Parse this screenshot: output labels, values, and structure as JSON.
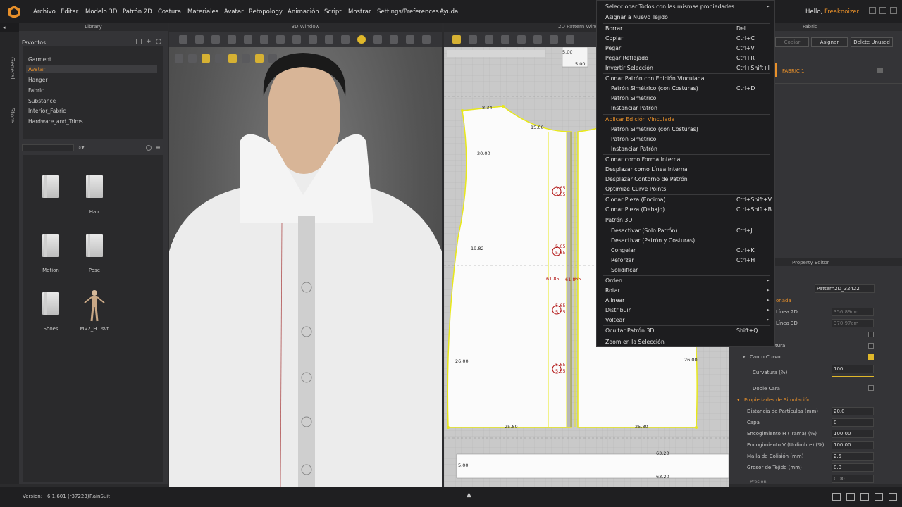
{
  "menubar": {
    "items": [
      "Archivo",
      "Editar",
      "Modelo 3D",
      "Patrón 2D",
      "Costura",
      "Materiales",
      "Avatar",
      "Retopology",
      "Animación",
      "Script",
      "Mostrar",
      "Settings/Preferences",
      "Ayuda"
    ],
    "hello": "Hello,",
    "user": "Freaknoizer"
  },
  "sidetabs": [
    "General",
    "Store"
  ],
  "library": {
    "title": "Library",
    "favorites_label": "Favoritos",
    "items": [
      "Garment",
      "Avatar",
      "Hanger",
      "Fabric",
      "Substance",
      "Interior_Fabric",
      "Hardware_and_Trims"
    ],
    "selected_index": 1,
    "thumbs": [
      {
        "label": ""
      },
      {
        "label": "Hair"
      },
      {
        "label": "Motion"
      },
      {
        "label": "Pose"
      },
      {
        "label": "Shoes"
      },
      {
        "label": "MV2_H...svt"
      }
    ]
  },
  "view3d": {
    "title": "3D Window"
  },
  "view2d": {
    "title": "2D Pattern Windo",
    "dims": [
      "8.34",
      "15.00",
      "20.00",
      "19.82",
      "26.00",
      "25.80",
      "25.80",
      "26.00",
      "5.00",
      "5.00",
      "63.20",
      "63.20",
      "5.00",
      "61.85",
      "61.8",
      "65"
    ],
    "red_dims": [
      "5.65",
      "5.65",
      "5.65",
      "5.65",
      "5.65",
      "5.65",
      "5.65",
      "5.65"
    ]
  },
  "fabric": {
    "title": "Fabric",
    "buttons": {
      "copy": "Copiar",
      "assign": "Asignar",
      "delete_unused": "Delete Unused"
    },
    "item": "FABRIC 1"
  },
  "property_editor": {
    "title": "Property Editor",
    "name_value": "Pattern2D_32422",
    "sel_section": "onada",
    "linea2d_label": "Línea 2D",
    "linea2d_value": "356.89cm",
    "linea3d_label": "Línea 3D",
    "linea3d_value": "370.97cm",
    "tura_label": "tura",
    "canto_curvo": "Canto Curvo",
    "curvatura_label": "Curvatura (%)",
    "curvatura_value": "100",
    "curvatura_fraction": 1.0,
    "doble_cara": "Doble Cara",
    "sim_section": "Propiedades de Simulación",
    "sim_props": [
      {
        "label": "Distancia de Partículas (mm)",
        "value": "20.0"
      },
      {
        "label": "Capa",
        "value": "0"
      },
      {
        "label": "Encogimiento H (Trama) (%)",
        "value": "100.00"
      },
      {
        "label": "Encogimiento V (Urdimbre) (%)",
        "value": "100.00"
      },
      {
        "label": "Malla de Colisión (mm)",
        "value": "2.5"
      },
      {
        "label": "Grosor de Tejido (mm)",
        "value": "0.0"
      },
      {
        "label": "",
        "value": "0.00"
      }
    ],
    "presion": "Presión"
  },
  "context_menu": {
    "items": [
      {
        "label": "Seleccionar Todos con las mismas propiedades",
        "shortcut": "",
        "arrow": true
      },
      {
        "label": "Asignar a Nuevo Tejido",
        "shortcut": ""
      },
      {
        "label": "Borrar",
        "shortcut": "Del"
      },
      {
        "label": "Copiar",
        "shortcut": "Ctrl+C"
      },
      {
        "label": "Pegar",
        "shortcut": "Ctrl+V"
      },
      {
        "label": "Pegar Reflejado",
        "shortcut": "Ctrl+R"
      },
      {
        "label": "Invertir Selección",
        "shortcut": "Ctrl+Shift+I"
      },
      {
        "label": "Clonar Patrón con Edición Vinculada",
        "shortcut": ""
      },
      {
        "label": "Patrón Simétrico (con Costuras)",
        "shortcut": "Ctrl+D",
        "sub": true
      },
      {
        "label": "Patrón Simétrico",
        "shortcut": "",
        "sub": true
      },
      {
        "label": "Instanciar Patrón",
        "shortcut": "",
        "sub": true
      },
      {
        "label": "Aplicar Edición Vinculada",
        "shortcut": "",
        "hl": true
      },
      {
        "label": "Patrón Simétrico (con Costuras)",
        "shortcut": "",
        "sub": true
      },
      {
        "label": "Patrón Simétrico",
        "shortcut": "",
        "sub": true
      },
      {
        "label": "Instanciar Patrón",
        "shortcut": "",
        "sub": true
      },
      {
        "label": "Clonar como Forma Interna",
        "shortcut": ""
      },
      {
        "label": "Desplazar como Línea Interna",
        "shortcut": ""
      },
      {
        "label": "Desplazar Contorno de Patrón",
        "shortcut": ""
      },
      {
        "label": "Optimize Curve Points",
        "shortcut": ""
      },
      {
        "label": "Clonar Pieza (Encima)",
        "shortcut": "Ctrl+Shift+V"
      },
      {
        "label": "Clonar Pieza (Debajo)",
        "shortcut": "Ctrl+Shift+B"
      },
      {
        "label": "Patrón 3D",
        "shortcut": ""
      },
      {
        "label": "Desactivar (Solo Patrón)",
        "shortcut": "Ctrl+J",
        "sub": true
      },
      {
        "label": "Desactivar (Patrón y Costuras)",
        "shortcut": "",
        "sub": true
      },
      {
        "label": "Congelar",
        "shortcut": "Ctrl+K",
        "sub": true
      },
      {
        "label": "Reforzar",
        "shortcut": "Ctrl+H",
        "sub": true
      },
      {
        "label": "Solidificar",
        "shortcut": "",
        "sub": true
      },
      {
        "label": "Orden",
        "shortcut": "",
        "arrow": true
      },
      {
        "label": "Rotar",
        "shortcut": "",
        "arrow": true
      },
      {
        "label": "Alinear",
        "shortcut": "",
        "arrow": true
      },
      {
        "label": "Distribuir",
        "shortcut": "",
        "arrow": true
      },
      {
        "label": "Voltear",
        "shortcut": "",
        "arrow": true
      },
      {
        "label": "Ocultar Patrón 3D",
        "shortcut": "Shift+Q"
      },
      {
        "label": "Zoom en la Selección",
        "shortcut": ""
      }
    ]
  },
  "status": {
    "version_label": "Version:",
    "version": "6.1.601 (r37223)",
    "project": "RainSuit"
  },
  "colors": {
    "accent": "#e8902a",
    "pattern_outline": "#e8e81a",
    "background": "#2b2b2d"
  }
}
